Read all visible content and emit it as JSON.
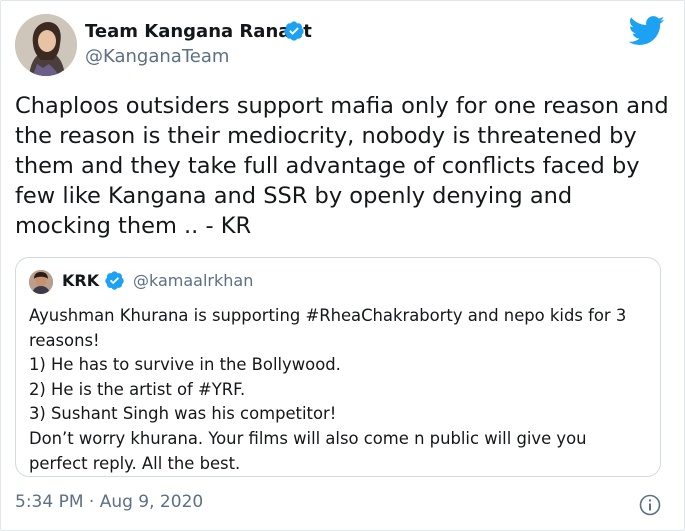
{
  "author": {
    "name": "Team Kangana Ranaut",
    "handle": "@KanganaTeam",
    "avatar_icon": "profile-photo"
  },
  "tweet": {
    "text": "Chaploos outsiders support mafia only for one reason and the reason is their mediocrity, nobody is threatened by them and they take full advantage of conflicts faced by few like Kangana and SSR by openly denying and mocking them .. - KR"
  },
  "quoted_tweet": {
    "name": "KRK",
    "handle": "@kamaalrkhan",
    "lines": [
      "Ayushman Khurana is supporting #RheaChakraborty and nepo kids for 3",
      "reasons!",
      "1) He has to survive in the Bollywood.",
      "2) He is the artist of #YRF.",
      "3) Sushant Singh was his competitor!",
      "Don’t worry khurana. Your films will also come n public will give you",
      "perfect reply. All the best."
    ]
  },
  "footer": {
    "timestamp": "5:34 PM · Aug 9, 2020"
  },
  "colors": {
    "twitter_blue": "#1da1f2",
    "text": "#14171a",
    "secondary": "#5b7083",
    "border": "#cfd9de"
  },
  "icons": {
    "verified": "verified-badge-icon",
    "brand": "twitter-bird-icon",
    "info": "info-icon"
  }
}
